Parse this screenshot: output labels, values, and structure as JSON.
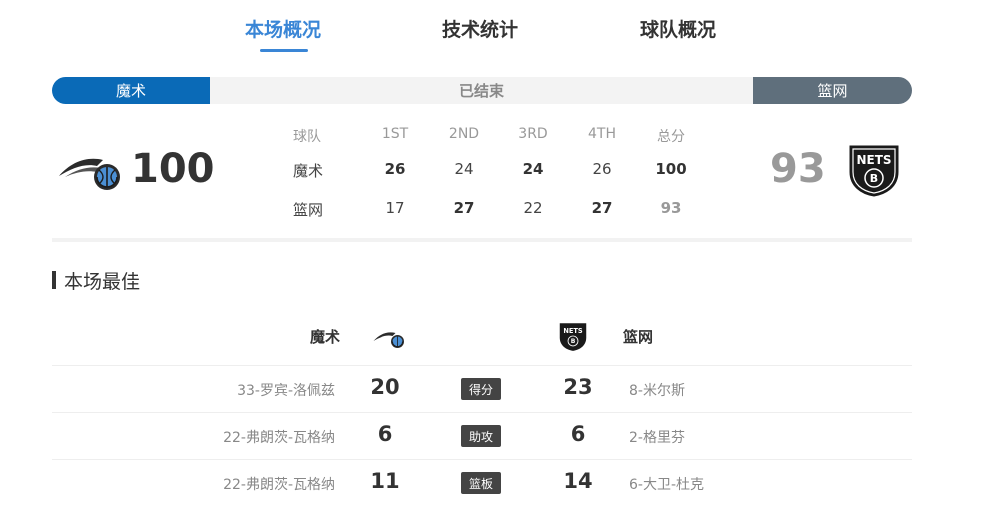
{
  "tabs": [
    {
      "label": "本场概况",
      "active": true
    },
    {
      "label": "技术统计",
      "active": false
    },
    {
      "label": "球队概况",
      "active": false
    }
  ],
  "status": {
    "home_team": "魔术",
    "state": "已结束",
    "away_team": "篮网"
  },
  "score": {
    "home": "100",
    "away": "93"
  },
  "quarters": {
    "headers": [
      "球队",
      "1ST",
      "2ND",
      "3RD",
      "4TH",
      "总分"
    ],
    "rows": [
      {
        "team": "魔术",
        "q1": "26",
        "q2": "24",
        "q3": "24",
        "q4": "26",
        "total": "100"
      },
      {
        "team": "篮网",
        "q1": "17",
        "q2": "27",
        "q3": "22",
        "q4": "27",
        "total": "93"
      }
    ]
  },
  "best": {
    "title": "本场最佳",
    "home_team": "魔术",
    "away_team": "篮网",
    "rows": [
      {
        "home_player": "33-罗宾-洛佩兹",
        "home_value": "20",
        "category": "得分",
        "away_value": "23",
        "away_player": "8-米尔斯"
      },
      {
        "home_player": "22-弗朗茨-瓦格纳",
        "home_value": "6",
        "category": "助攻",
        "away_value": "6",
        "away_player": "2-格里芬"
      },
      {
        "home_player": "22-弗朗茨-瓦格纳",
        "home_value": "11",
        "category": "篮板",
        "away_value": "14",
        "away_player": "6-大卫-杜克"
      }
    ]
  },
  "icons": {
    "home_logo": "orlando-magic-logo-icon",
    "away_logo": "brooklyn-nets-logo-icon"
  },
  "colors": {
    "accent": "#3a86d6",
    "home": "#0a6ab7",
    "away": "#5f6f7c"
  }
}
